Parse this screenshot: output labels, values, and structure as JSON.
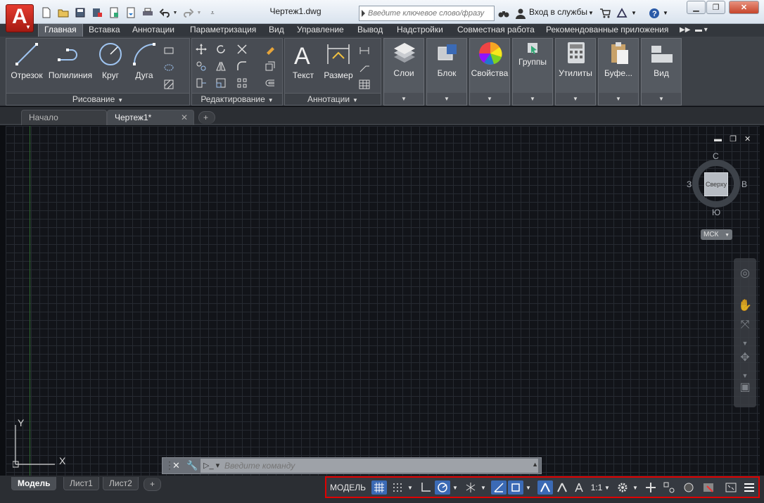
{
  "titlebar": {
    "doc_title": "Чертеж1.dwg",
    "search_placeholder": "Введите ключевое слово/фразу",
    "signin_label": "Вход в службы",
    "help_label": "?"
  },
  "ribbon_tabs": [
    "Главная",
    "Вставка",
    "Аннотации",
    "Параметризация",
    "Вид",
    "Управление",
    "Вывод",
    "Надстройки",
    "Совместная работа",
    "Рекомендованные приложения"
  ],
  "panels": {
    "draw": {
      "title": "Рисование",
      "tools": [
        "Отрезок",
        "Полилиния",
        "Круг",
        "Дуга"
      ]
    },
    "modify": {
      "title": "Редактирование"
    },
    "annotation": {
      "title": "Аннотации",
      "tools": [
        "Текст",
        "Размер"
      ]
    },
    "layers": "Слои",
    "block": "Блок",
    "properties": "Свойства",
    "groups": "Группы",
    "utilities": "Утилиты",
    "clipboard": "Буфе...",
    "view": "Вид"
  },
  "file_tabs": {
    "start": "Начало",
    "drawing": "Чертеж1*",
    "add": "+"
  },
  "viewcube": {
    "top_face": "Сверху",
    "north": "С",
    "south": "Ю",
    "west": "З",
    "east": "В",
    "ucs_menu": "МСК"
  },
  "ucs": {
    "y_label": "Y",
    "x_label": "X"
  },
  "command_line": {
    "placeholder": "Введите команду"
  },
  "layout_tabs": [
    "Модель",
    "Лист1",
    "Лист2"
  ],
  "statusbar": {
    "model_label": "МОДЕЛЬ",
    "scale_label": "1:1"
  },
  "colors": {
    "accent": "#3b6ab5",
    "highlight_border": "#e00000",
    "app_red": "#c8251a"
  }
}
